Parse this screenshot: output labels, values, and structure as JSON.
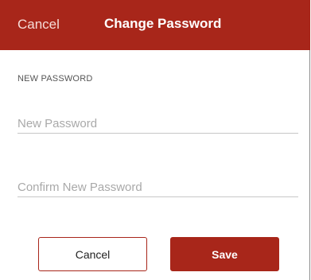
{
  "navbar": {
    "cancel_label": "Cancel",
    "title": "Change Password",
    "background_color": "#a8261a"
  },
  "form": {
    "section_label": "NEW PASSWORD",
    "new_password": {
      "value": "",
      "placeholder": "New Password"
    },
    "confirm_password": {
      "value": "",
      "placeholder": "Confirm New Password"
    }
  },
  "buttons": {
    "cancel_label": "Cancel",
    "save_label": "Save"
  },
  "colors": {
    "accent": "#a8261a"
  }
}
